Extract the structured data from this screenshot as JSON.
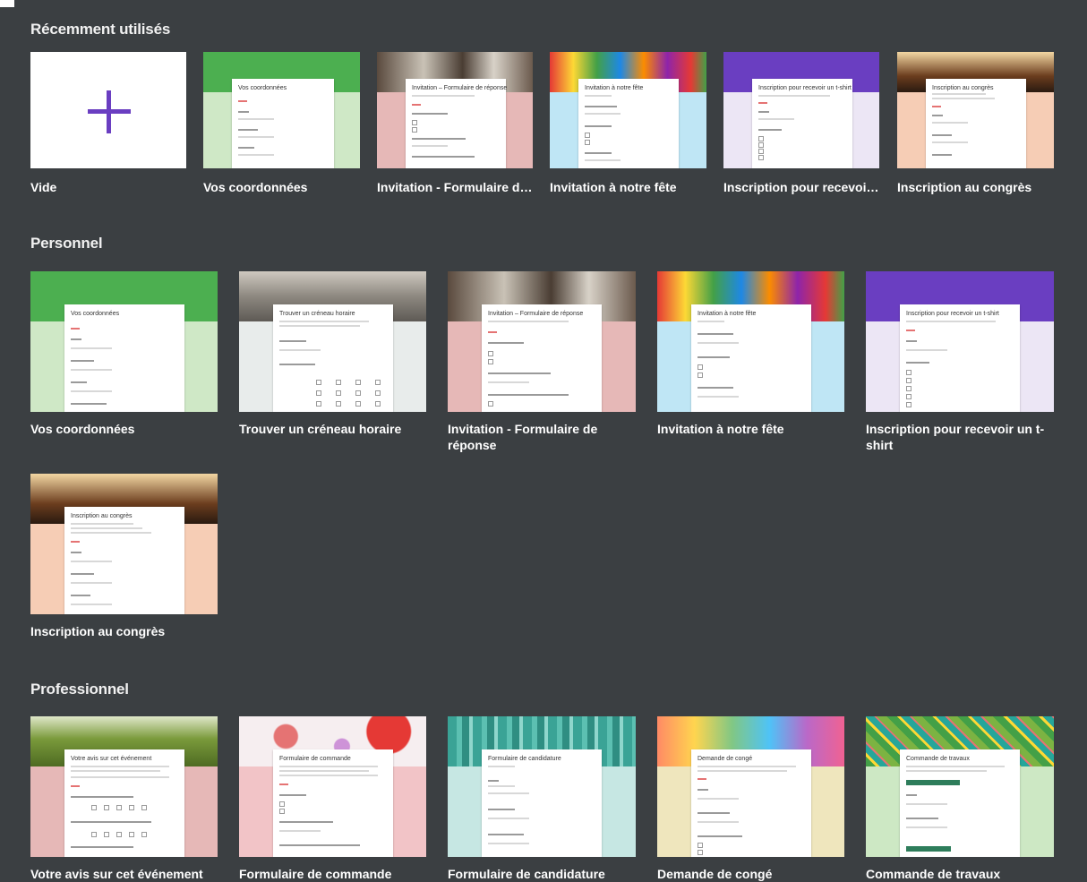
{
  "sections": {
    "recent": {
      "title": "Récemment utilisés",
      "items": [
        {
          "label": "Vide"
        },
        {
          "label": "Vos coordonnées",
          "form_title": "Vos coordonnées"
        },
        {
          "label": "Invitation - Formulaire de ...",
          "form_title": "Invitation – Formulaire de réponse"
        },
        {
          "label": "Invitation à notre fête",
          "form_title": "Invitation à notre fête"
        },
        {
          "label": "Inscription pour recevoir ...",
          "form_title": "Inscription pour recevoir un t-shirt"
        },
        {
          "label": "Inscription au congrès",
          "form_title": "Inscription au congrès"
        }
      ]
    },
    "personal": {
      "title": "Personnel",
      "items": [
        {
          "label": "Vos coordonnées",
          "form_title": "Vos coordonnées"
        },
        {
          "label": "Trouver un créneau horaire",
          "form_title": "Trouver un créneau horaire"
        },
        {
          "label": "Invitation - Formulaire de réponse",
          "form_title": "Invitation – Formulaire de réponse"
        },
        {
          "label": "Invitation à notre fête",
          "form_title": "Invitation à notre fête"
        },
        {
          "label": "Inscription pour recevoir un t-shirt",
          "form_title": "Inscription pour recevoir un t-shirt"
        },
        {
          "label": "Inscription au congrès",
          "form_title": "Inscription au congrès"
        }
      ]
    },
    "professional": {
      "title": "Professionnel",
      "items": [
        {
          "label": "Votre avis sur cet événement",
          "form_title": "Votre avis sur cet événement"
        },
        {
          "label": "Formulaire de commande",
          "form_title": "Formulaire de commande"
        },
        {
          "label": "Formulaire de candidature",
          "form_title": "Formulaire de candidature"
        },
        {
          "label": "Demande de congé",
          "form_title": "Demande de congé"
        },
        {
          "label": "Commande de travaux",
          "form_title": "Commande de travaux"
        }
      ]
    }
  },
  "colors": {
    "background": "#3b3f42",
    "accent_purple": "#6a3ec1",
    "green": "#4caf50",
    "pink": "#e6b8b7",
    "light_blue": "#bfe6f5",
    "lavender": "#ece6f5",
    "peach": "#f6cdb5",
    "teal": "#3aa396"
  },
  "icons": {
    "blank_form": "plus-icon"
  }
}
